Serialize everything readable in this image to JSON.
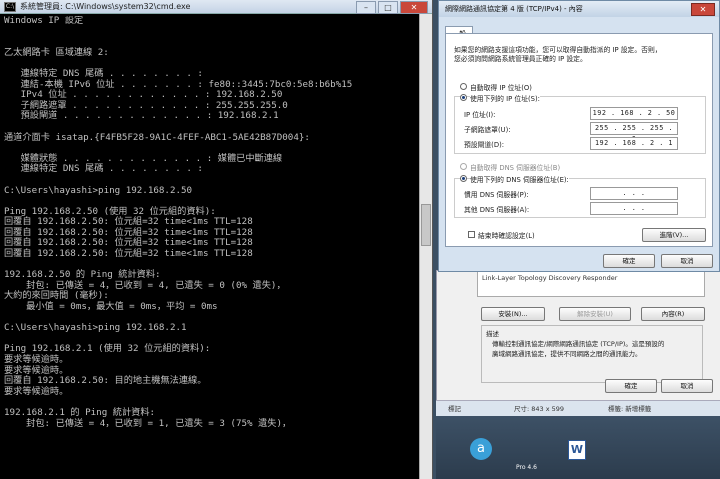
{
  "cmd": {
    "title": "系統管理員: C:\\Windows\\system32\\cmd.exe",
    "icon": "cmd-icon",
    "lines": [
      "Windows IP 設定",
      "",
      "",
      "乙太網路卡 區域連線 2:",
      "",
      "   連線特定 DNS 尾碼 . . . . . . . . :",
      "   連結-本機 IPv6 位址 . . . . . . . : fe80::3445:7bc0:5e8:b6b%15",
      "   IPv4 位址 . . . . . . . . . . . . : 192.168.2.50",
      "   子網路遮罩 . . . . . . . . . . . . : 255.255.255.0",
      "   預設閘道 . . . . . . . . . . . . . : 192.168.2.1",
      "",
      "通道介面卡 isatap.{F4FB5F28-9A1C-4FEF-ABC1-5AE42B87D004}:",
      "",
      "   媒體狀態 . . . . . . . . . . . . . : 媒體已中斷連線",
      "   連線特定 DNS 尾碼 . . . . . . . . :",
      "",
      "C:\\Users\\hayashi>ping 192.168.2.50",
      "",
      "Ping 192.168.2.50 (使用 32 位元組的資料):",
      "回覆自 192.168.2.50: 位元組=32 time<1ms TTL=128",
      "回覆自 192.168.2.50: 位元組=32 time<1ms TTL=128",
      "回覆自 192.168.2.50: 位元組=32 time<1ms TTL=128",
      "回覆自 192.168.2.50: 位元組=32 time<1ms TTL=128",
      "",
      "192.168.2.50 的 Ping 統計資料:",
      "    封包: 已傳送 = 4，已收到 = 4, 已遺失 = 0 (0% 遺失)，",
      "大約的來回時間 (毫秒):",
      "    最小值 = 0ms，最大值 = 0ms，平均 = 0ms",
      "",
      "C:\\Users\\hayashi>ping 192.168.2.1",
      "",
      "Ping 192.168.2.1 (使用 32 位元組的資料):",
      "要求等候逾時。",
      "要求等候逾時。",
      "回覆自 192.168.2.50: 目的地主機無法連線。",
      "要求等候逾時。",
      "",
      "192.168.2.1 的 Ping 統計資料:",
      "    封包: 已傳送 = 4，已收到 = 1, 已遺失 = 3 (75% 遺失)，"
    ]
  },
  "dialog": {
    "title": "網際網路通訊協定第 4 版 (TCP/IPv4) - 內容",
    "tab": "一般",
    "intro1": "如果您的網路支援這項功能，您可以取得自動指派的 IP 設定。否則，",
    "intro2": "您必須詢問網路系統管理員正確的 IP 設定。",
    "auto_ip": "自動取得 IP 位址(O)",
    "manual_ip": "使用下列的 IP 位址(S):",
    "ip_label": "IP 位址(I):",
    "ip_value": "192 . 168 .  2  . 50",
    "mask_label": "子網路遮罩(U):",
    "mask_value": "255 . 255 . 255 .  0",
    "gw_label": "預設閘道(D):",
    "gw_value": "192 . 168 .  2  .  1",
    "auto_dns": "自動取得 DNS 伺服器位址(B)",
    "manual_dns": "使用下列的 DNS 伺服器位址(E):",
    "dns1_label": "慣用 DNS 伺服器(P):",
    "dns2_label": "其他 DNS 伺服器(A):",
    "empty_ip": " .  .  . ",
    "validate": "結束時確認設定(L)",
    "advanced": "進階(V)...",
    "ok": "確定",
    "cancel": "取消"
  },
  "netwin": {
    "list_item": "Link-Layer Topology Discovery Responder",
    "install": "安裝(N)...",
    "uninstall": "解除安裝(U)",
    "properties": "內容(R)",
    "desc_title": "描述",
    "desc1": "傳輸控制通訊協定/網際網路通訊協定 (TCP/IP)。這是預設的",
    "desc2": "廣域網路通訊協定，提供不同網路之間的通訊能力。",
    "ok": "確定",
    "cancel": "取消"
  },
  "statusbar": {
    "left": "標記",
    "size": "尺寸: 843 x 599",
    "tag": "標籤: 新增標籤"
  },
  "desktop": {
    "icon2_label": "Pro 4.6"
  }
}
